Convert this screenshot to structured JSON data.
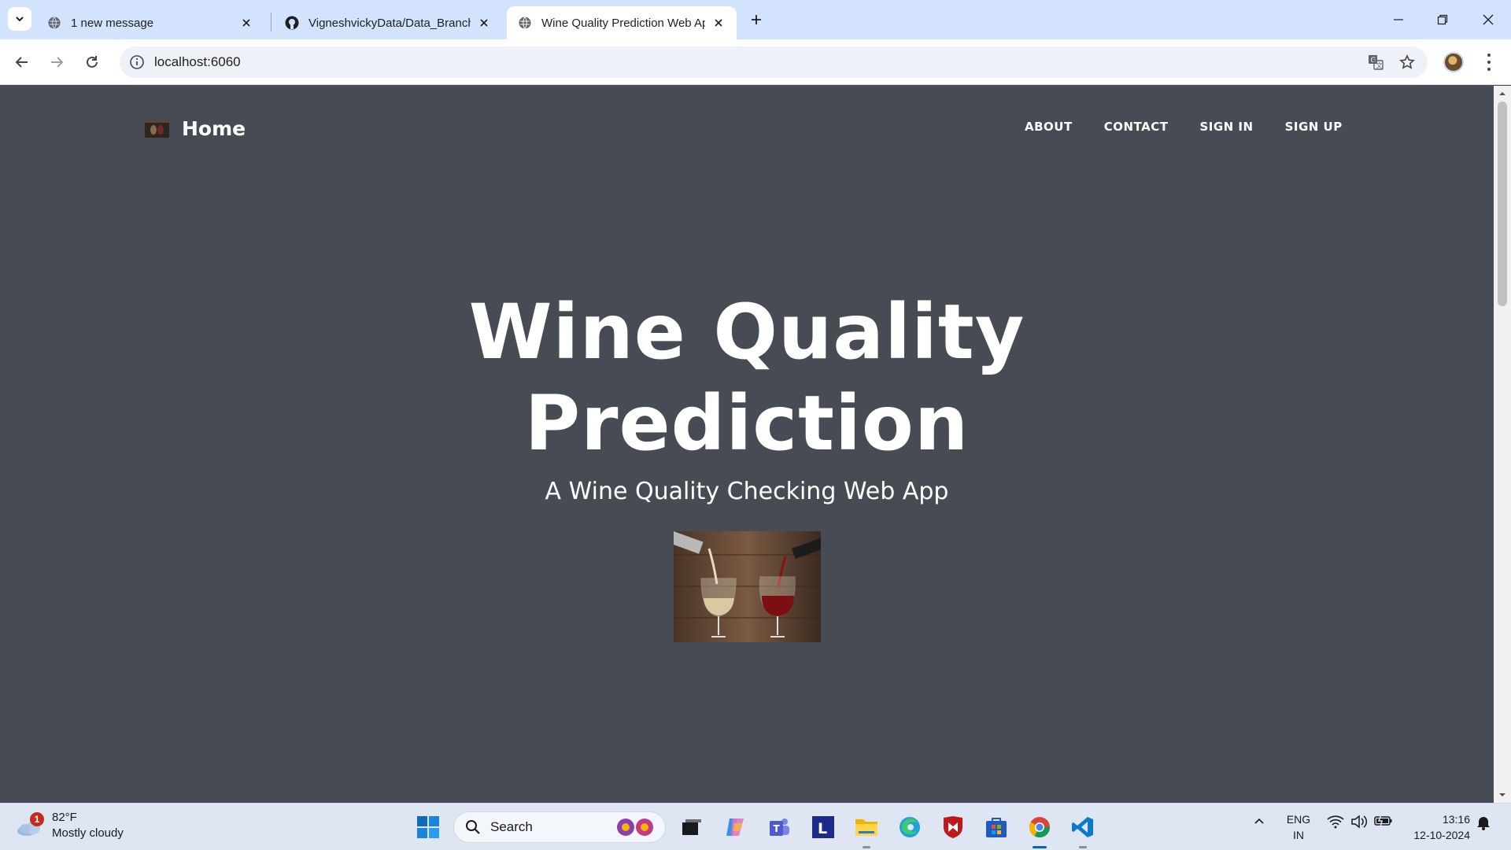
{
  "browser": {
    "tabs": [
      {
        "title": "1 new message",
        "active": false
      },
      {
        "title": "VigneshvickyData/Data_Branch",
        "active": false
      },
      {
        "title": "Wine Quality Prediction Web Ap",
        "active": true
      }
    ],
    "url": "localhost:6060"
  },
  "page": {
    "brand": "Home",
    "nav": [
      "ABOUT",
      "CONTACT",
      "SIGN IN",
      "SIGN UP"
    ],
    "hero_title_line1": "Wine Quality",
    "hero_title_line2": "Prediction",
    "hero_subtitle": "A Wine Quality Checking Web App"
  },
  "taskbar": {
    "weather_temp": "82°F",
    "weather_desc": "Mostly cloudy",
    "weather_badge": "1",
    "search_label": "Search",
    "lang_1": "ENG",
    "lang_2": "IN",
    "time": "13:16",
    "date": "12-10-2024"
  },
  "colors": {
    "page_background": "#474b53",
    "tabstrip": "#d3e3fd",
    "taskbar": "#dde6f2"
  }
}
